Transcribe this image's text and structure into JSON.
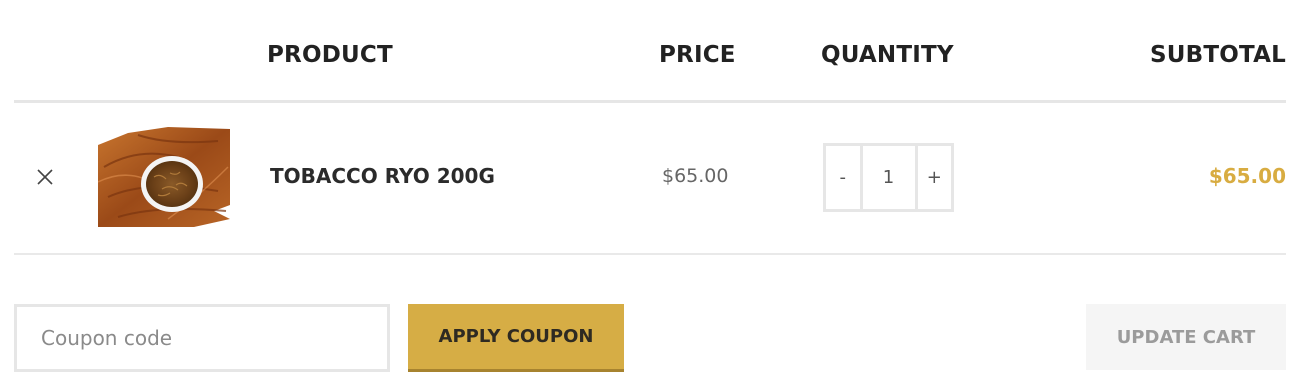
{
  "table": {
    "headers": {
      "product": "PRODUCT",
      "price": "PRICE",
      "quantity": "QUANTITY",
      "subtotal": "SUBTOTAL"
    },
    "rows": [
      {
        "remove_icon": "close-icon",
        "thumbnail": "tobacco-bowl-image",
        "name": "TOBACCO RYO 200G",
        "price": "$65.00",
        "quantity": {
          "decrement": "-",
          "value": "1",
          "increment": "+"
        },
        "subtotal": "$65.00"
      }
    ]
  },
  "actions": {
    "coupon_placeholder": "Coupon code",
    "apply_coupon": "APPLY COUPON",
    "update_cart": "UPDATE CART"
  },
  "colors": {
    "accent": "#d6ad45",
    "subtotal": "#d8ac41",
    "border": "#e6e6e6",
    "update_bg": "#f5f5f5"
  }
}
